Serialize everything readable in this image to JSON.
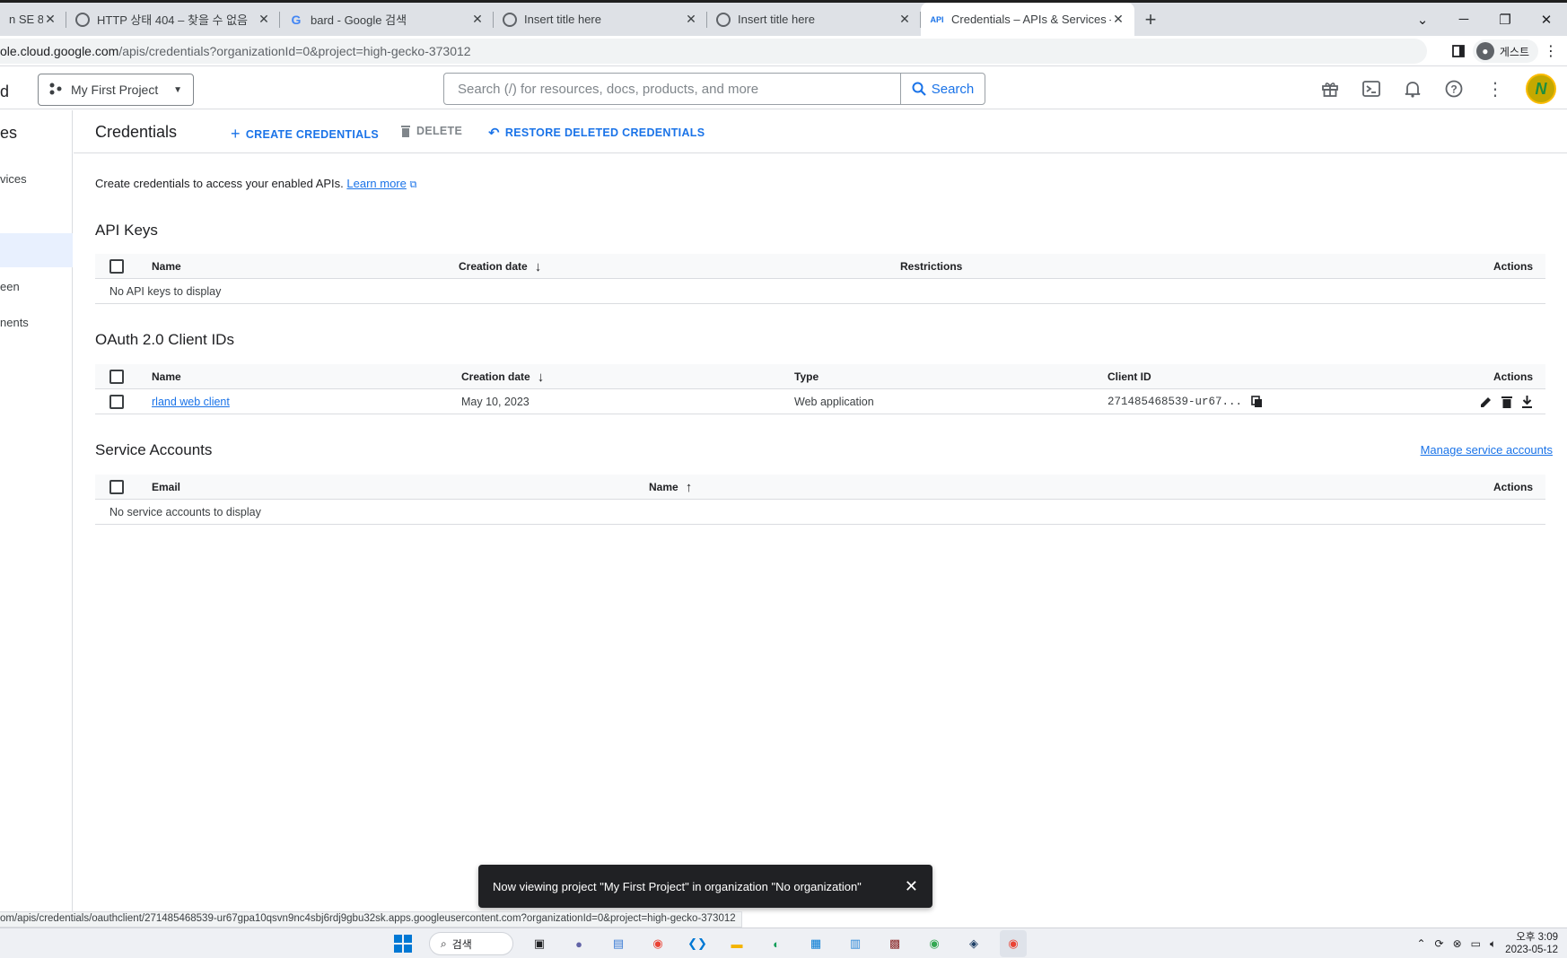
{
  "browser": {
    "tabs": [
      {
        "title": "n SE 8 )",
        "favicon": "none"
      },
      {
        "title": "HTTP 상태 404 – 찾을 수 없음",
        "favicon": "globe-icon"
      },
      {
        "title": "bard - Google 검색",
        "favicon": "google-icon"
      },
      {
        "title": "Insert title here",
        "favicon": "globe-icon"
      },
      {
        "title": "Insert title here",
        "favicon": "globe-icon"
      },
      {
        "title": "Credentials – APIs & Services –",
        "favicon": "api-icon",
        "favicon_text": "API",
        "active": true
      }
    ],
    "url_host": "ole.cloud.google.com",
    "url_path": "/apis/credentials?organizationId=0&project=high-gecko-373012",
    "profile_label": "게스트"
  },
  "header": {
    "left_fragment": "d",
    "project": "My First Project",
    "search_placeholder": "Search (/) for resources, docs, products, and more",
    "search_button": "Search",
    "avatar_letter": "N"
  },
  "nav": {
    "title_fragment": "es",
    "items": [
      {
        "label": "vices",
        "active": false
      },
      {
        "label": "",
        "active": true
      },
      {
        "label": "een",
        "active": false
      },
      {
        "label": "nents",
        "active": false
      }
    ]
  },
  "page": {
    "title": "Credentials",
    "actions": {
      "create": "CREATE CREDENTIALS",
      "delete": "DELETE",
      "restore": "RESTORE DELETED CREDENTIALS"
    },
    "intro_text": "Create credentials to access your enabled APIs.",
    "learn_more": "Learn more"
  },
  "api_keys": {
    "title": "API Keys",
    "columns": {
      "name": "Name",
      "creation_date": "Creation date",
      "restrictions": "Restrictions",
      "actions": "Actions"
    },
    "empty": "No API keys to display"
  },
  "oauth": {
    "title": "OAuth 2.0 Client IDs",
    "columns": {
      "name": "Name",
      "creation_date": "Creation date",
      "type": "Type",
      "client_id": "Client ID",
      "actions": "Actions"
    },
    "rows": [
      {
        "name": "rland web client",
        "creation_date": "May 10, 2023",
        "type": "Web application",
        "client_id": "271485468539-ur67..."
      }
    ]
  },
  "service_accounts": {
    "title": "Service Accounts",
    "manage_link": "Manage service accounts",
    "columns": {
      "email": "Email",
      "name": "Name",
      "actions": "Actions"
    },
    "empty": "No service accounts to display"
  },
  "snackbar": {
    "message": "Now viewing project \"My First Project\" in organization \"No organization\""
  },
  "status_url": "om/apis/credentials/oauthclient/271485468539-ur67gpa10qsvn9nc4sbj6rdj9gbu32sk.apps.googleusercontent.com?organizationId=0&project=high-gecko-373012",
  "taskbar": {
    "search_label": "검색",
    "time": "오후 3:09",
    "date": "2023-05-12"
  }
}
